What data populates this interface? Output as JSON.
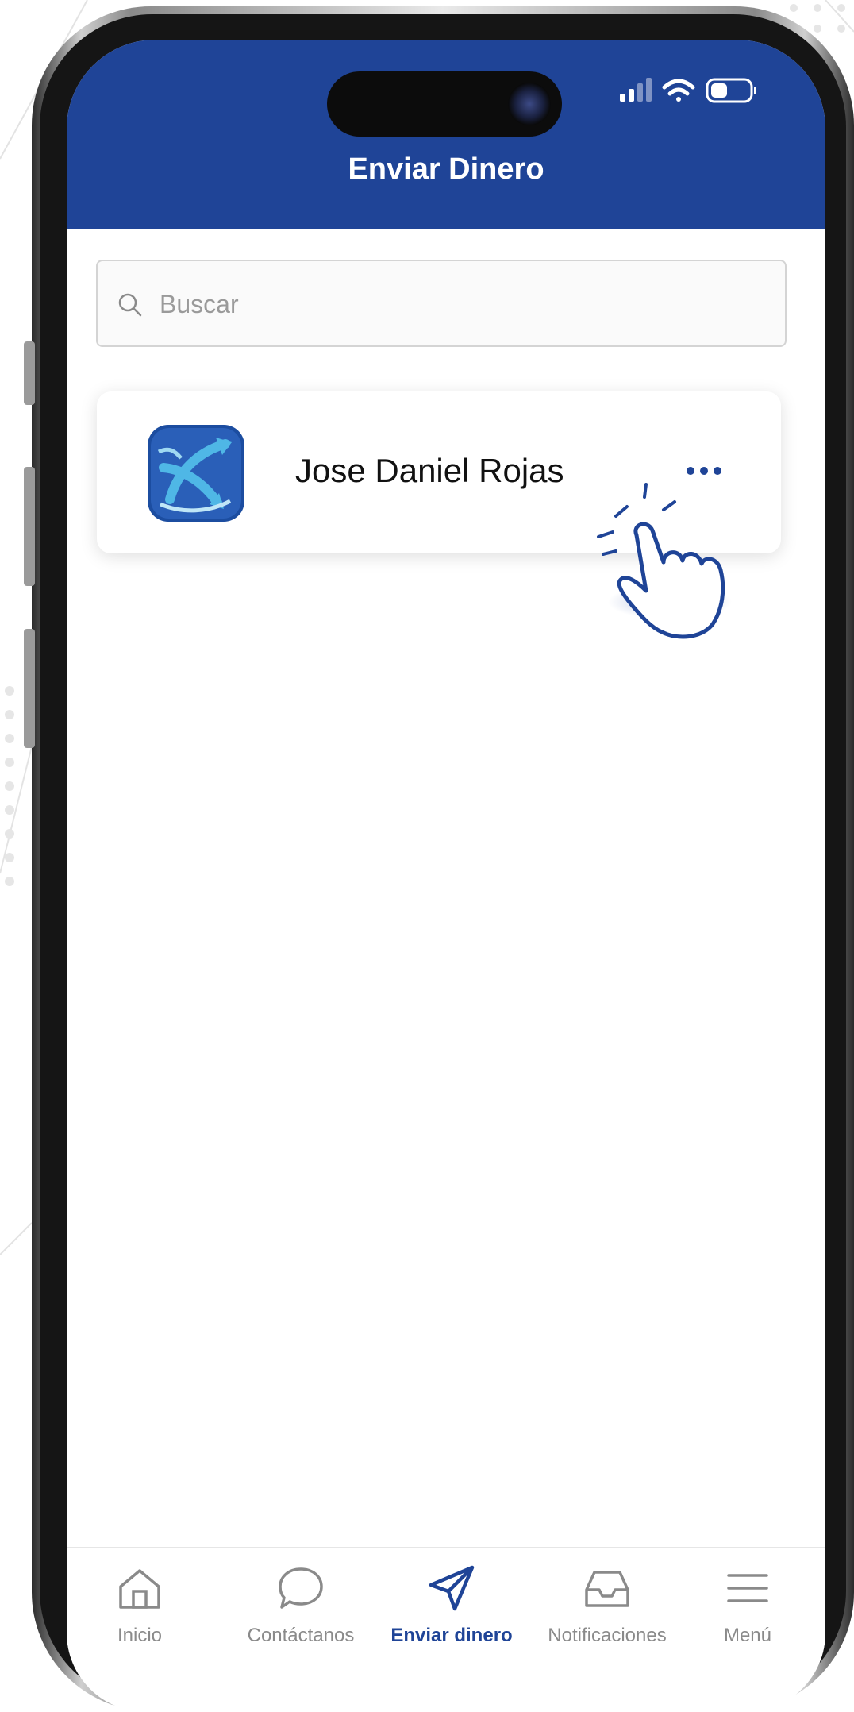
{
  "header": {
    "title": "Enviar Dinero"
  },
  "search": {
    "placeholder": "Buscar",
    "value": ""
  },
  "contacts": [
    {
      "name": "Jose Daniel Rojas",
      "more_icon": "more-dots-icon",
      "avatar_icon": "bank-logo-icon"
    }
  ],
  "bottom_nav": {
    "items": [
      {
        "label": "Inicio",
        "icon": "home-icon",
        "active": false
      },
      {
        "label": "Contáctanos",
        "icon": "chat-icon",
        "active": false
      },
      {
        "label": "Enviar dinero",
        "icon": "send-icon",
        "active": true
      },
      {
        "label": "Notificaciones",
        "icon": "inbox-icon",
        "active": false
      },
      {
        "label": "Menú",
        "icon": "menu-icon",
        "active": false
      }
    ]
  },
  "colors": {
    "brand": "#1f4497",
    "active_nav": "#1f4497",
    "inactive_nav": "#8a8a8a",
    "logo_light": "#4fb7e6"
  }
}
